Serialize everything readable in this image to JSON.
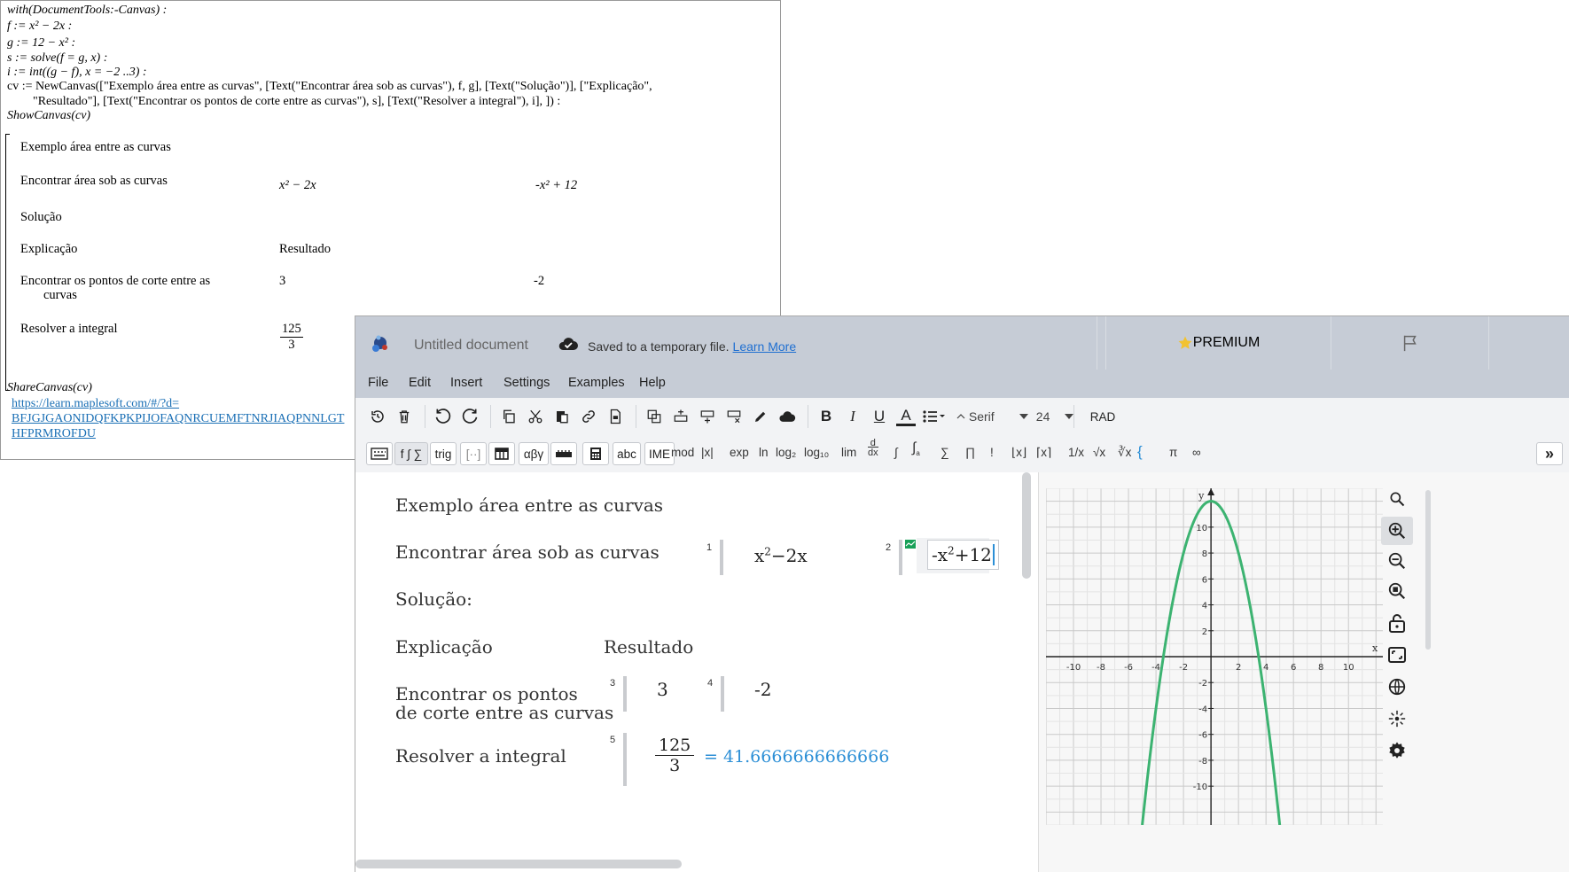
{
  "maple": {
    "lines": [
      "with(DocumentTools:-Canvas) :",
      "f := x² − 2x :",
      "g := 12 − x² :",
      "s := solve(f = g, x) :",
      "i := int((g − f), x = −2 ..3) :",
      "cv := NewCanvas([\"Exemplo área entre as curvas\", [Text(\"Encontrar área sob as curvas\"), f, g], [Text(\"Solução\")], [\"Explicação\",",
      "\"Resultado\"], [Text(\"Encontrar os pontos de corte entre as curvas\"), s], [Text(\"Resolver a integral\"), i], ]) :",
      "ShowCanvas(cv)"
    ],
    "canvas": {
      "title": "Exemplo área entre as curvas",
      "row1_label": "Encontrar área sob as curvas",
      "row1_f": "x² − 2x",
      "row1_g": "-x² + 12",
      "solucao": "Solução",
      "explicacao": "Explicação",
      "resultado": "Resultado",
      "row3_label_1": "Encontrar os pontos de corte entre as",
      "row3_label_2": "curvas",
      "row3_a": "3",
      "row3_b": "-2",
      "row4_label": "Resolver a integral",
      "row4_num": "125",
      "row4_den": "3"
    },
    "share_cmd": "ShareCanvas(cv)",
    "share_link_1": "https://learn.maplesoft.com/#/?d=",
    "share_link_2": "BFJGJGAONIDQFKPKPIJOFAQNRCUEMFTNRJIAQPNNLGT",
    "share_link_3": "HFPRMROFDU"
  },
  "app": {
    "doc_title": "Untitled document",
    "saved_text": "Saved to a temporary file.",
    "learn_more": "Learn More",
    "premium": "PREMIUM",
    "menu": [
      "File",
      "Edit",
      "Insert",
      "Settings",
      "Examples",
      "Help"
    ],
    "font_name": "Serif",
    "font_size": "24",
    "angle_mode": "RAD",
    "palette_buttons": [
      "f ∫ ∑",
      "trig",
      "[··]",
      "αβγ",
      "abc",
      "IME"
    ],
    "functions": [
      "mod",
      "|x|",
      "exp",
      "ln",
      "log₂",
      "log₁₀",
      "lim",
      "∫",
      "∑",
      "∏",
      "!",
      "⌊x⌋",
      "⌈x⌉",
      "1/x",
      "√x",
      "∛x",
      "π",
      "∞"
    ],
    "doc": {
      "title": "Exemplo área entre as curvas",
      "row1_label": "Encontrar área sob as curvas",
      "eq1_num": "1",
      "eq1_expr": "x²−2x",
      "eq2_num": "2",
      "eq2_expr": "-x²+12",
      "solucao": "Solução:",
      "explicacao": "Explicação",
      "resultado": "Resultado",
      "row3_label_1": "Encontrar os pontos",
      "row3_label_2": "de corte entre as curvas",
      "eq3_num": "3",
      "eq3_val": "3",
      "eq4_num": "4",
      "eq4_val": "-2",
      "row4_label": "Resolver a integral",
      "eq5_num": "5",
      "eq5_num_top": "125",
      "eq5_den": "3",
      "eq5_result": "= 41.6666666666666"
    }
  },
  "chart_data": {
    "type": "line",
    "xlabel": "x",
    "ylabel": "y",
    "xlim": [
      -12,
      12.5
    ],
    "ylim": [
      -13,
      13
    ],
    "xticks": [
      -10,
      -8,
      -6,
      -4,
      -2,
      2,
      4,
      6,
      8,
      10
    ],
    "yticks": [
      -10,
      -8,
      -6,
      -4,
      -2,
      2,
      4,
      6,
      8,
      10
    ],
    "grid": true,
    "series": [
      {
        "name": "",
        "expression": "-x^2+12",
        "color": "#3cb371",
        "x": [
          -5,
          -4,
          -3,
          -2,
          -1,
          0,
          1,
          2,
          3,
          4,
          5
        ],
        "y": [
          -13,
          -4,
          3,
          8,
          11,
          12,
          11,
          8,
          3,
          -4,
          -13
        ]
      }
    ]
  }
}
